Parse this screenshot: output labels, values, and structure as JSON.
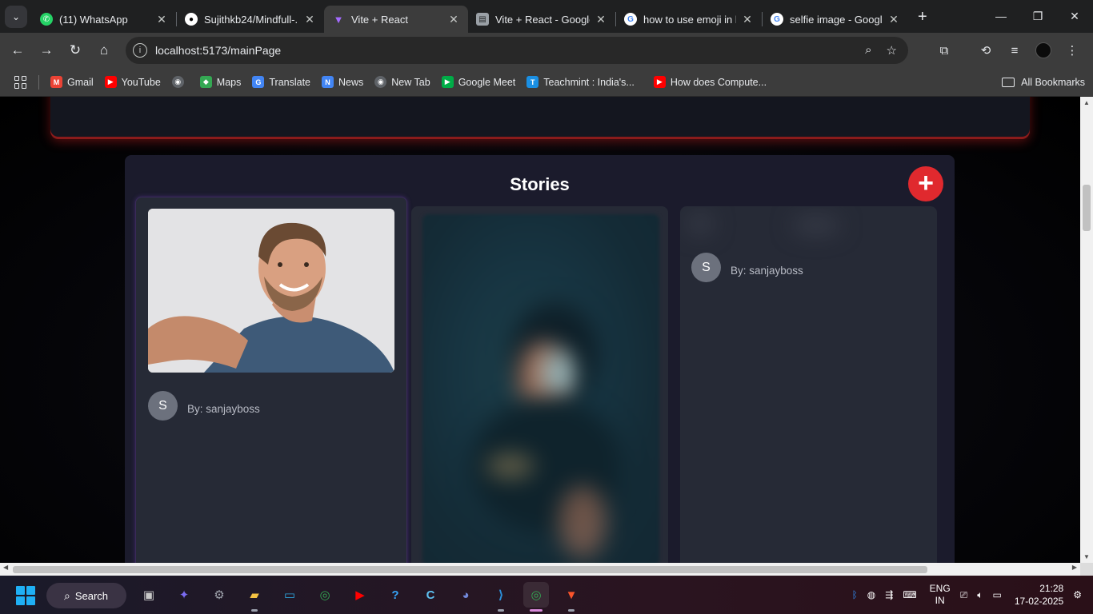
{
  "tabs": [
    {
      "title": "(11) WhatsApp",
      "icon": "whatsapp-icon",
      "color": "#25d366",
      "glyph": "✆"
    },
    {
      "title": "Sujithkb24/Mindfull-...",
      "icon": "github-icon",
      "color": "#ffffff",
      "glyph": "●"
    },
    {
      "title": "Vite + React",
      "icon": "vite-icon",
      "color": "#a46bff",
      "glyph": "▼"
    },
    {
      "title": "Vite + React - Google...",
      "icon": "google-docs-icon",
      "color": "#c9cdd2",
      "glyph": "▤"
    },
    {
      "title": "how to use emoji in l...",
      "icon": "google-icon",
      "color": "#ffffff",
      "glyph": "G"
    },
    {
      "title": "selfie image - Google...",
      "icon": "google-icon",
      "color": "#ffffff",
      "glyph": "G"
    }
  ],
  "address": {
    "url": "localhost:5173/mainPage"
  },
  "bookmarks": [
    {
      "label": "Gmail",
      "icon": "gmail-icon",
      "color": "#ea4335",
      "glyph": "M"
    },
    {
      "label": "YouTube",
      "icon": "youtube-icon",
      "color": "#ff0000",
      "glyph": "▶"
    },
    {
      "label": "",
      "icon": "globe-icon",
      "color": "#5f6368",
      "glyph": "◉"
    },
    {
      "label": "Maps",
      "icon": "maps-icon",
      "color": "#34a853",
      "glyph": "◆"
    },
    {
      "label": "Translate",
      "icon": "translate-icon",
      "color": "#4285f4",
      "glyph": "G"
    },
    {
      "label": "News",
      "icon": "news-icon",
      "color": "#4285f4",
      "glyph": "N"
    },
    {
      "label": "New Tab",
      "icon": "globe-icon",
      "color": "#5f6368",
      "glyph": "◉"
    },
    {
      "label": "Google Meet",
      "icon": "meet-icon",
      "color": "#00ac47",
      "glyph": "▶"
    },
    {
      "label": "Teachmint : India's...",
      "icon": "teachmint-icon",
      "color": "#1a8fe3",
      "glyph": "T"
    },
    {
      "label": "How does Compute...",
      "icon": "youtube-icon",
      "color": "#ff0000",
      "glyph": "▶"
    }
  ],
  "all_bookmarks_label": "All Bookmarks",
  "stories": {
    "title": "Stories",
    "add_label": "+",
    "items": [
      {
        "avatar_letter": "S",
        "byline": "By: sanjayboss"
      },
      {
        "avatar_letter": "S",
        "byline": "By: sanjayboss"
      }
    ]
  },
  "taskbar": {
    "search_label": "Search",
    "lang_top": "ENG",
    "lang_bottom": "IN",
    "time": "21:28",
    "date": "17-02-2025"
  }
}
